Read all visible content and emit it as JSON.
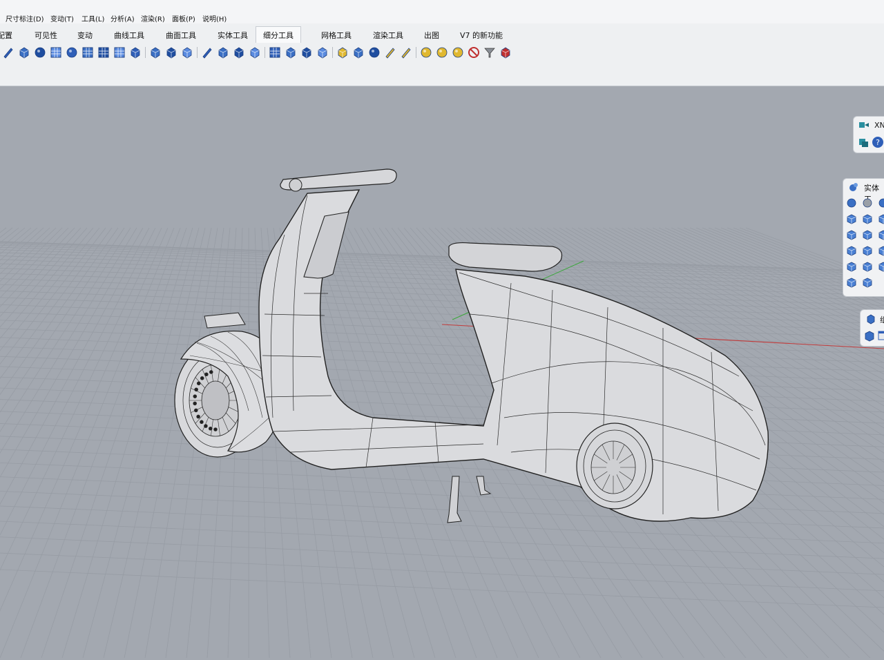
{
  "menu": [
    "尺寸标注(D)",
    "变动(T)",
    "工具(L)",
    "分析(A)",
    "渲染(R)",
    "面板(P)",
    "说明(H)"
  ],
  "tabs": [
    "配置",
    "可见性",
    "变动",
    "曲线工具",
    "曲面工具",
    "实体工具",
    "细分工具",
    "网格工具",
    "渲染工具",
    "出图",
    "V7 的新功能"
  ],
  "active_tab_index": 6,
  "toolbar_icons": [
    "curve-tool-icon",
    "solid-box-icon",
    "sphere-chain-icon",
    "surface-grid-icon",
    "sphere-link-icon",
    "grid-panel-icon",
    "grid-net-icon",
    "grid-select-icon",
    "bucket-icon",
    "bridge-icon",
    "chain-icon",
    "crease-icon",
    "pencil-icon",
    "split-shape-icon",
    "layer-stack-icon",
    "extract-icon",
    "mesh-grid-icon",
    "list-icon",
    "wrench-icon",
    "cube-group-icon",
    "cube-yellow-icon",
    "hammer-icon",
    "globe-icon",
    "brush-icon",
    "paint-brush-icon",
    "sphere-gold-icon",
    "sphere-gold-2-icon",
    "sphere-gold-3-icon",
    "no-entry-icon",
    "filter-icon",
    "vertex-red-icon"
  ],
  "colors": {
    "viewport_bg": "#a3a8b0",
    "grid_line": "#9499a1",
    "x_axis": "#c23a3a",
    "y_axis": "#3aa83a",
    "accent_blue": "#2f5fb8"
  },
  "panels": {
    "top": {
      "title": "XN",
      "icons": [
        "layer-arrow-icon",
        "help-icon"
      ]
    },
    "solid": {
      "title": "实体工",
      "icons": [
        "sphere-pair-icon",
        "sphere-gray-icon",
        "sphere-half-icon",
        "box-open-icon",
        "box-split-icon",
        "box-blue-icon",
        "cube-blue-icon",
        "box-shell-icon",
        "box-edge-icon",
        "box-star-icon",
        "box-arrow-icon",
        "box-move-icon",
        "box-plain-icon",
        "box-rotate-icon",
        "box-shadow-icon",
        "gear-cluster-icon",
        "bucket-small-icon"
      ]
    },
    "third": {
      "title": "组",
      "icons": [
        "cube-small-icon",
        "window-icon"
      ]
    }
  }
}
